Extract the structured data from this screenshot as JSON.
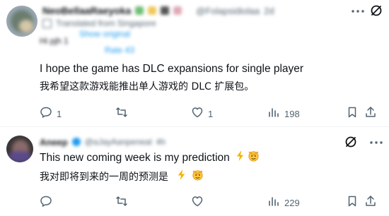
{
  "tweet1": {
    "display_name": "NeoBellaaRaeyoka",
    "handle": "@Folapsidiolaa",
    "time": "2d",
    "translate_line": "Translated from Singapore",
    "show_original": "Show original",
    "tag_a": "Hi pjh 1",
    "tag_b": "Rate 43",
    "text_en": "I hope the game has DLC expansions for single player",
    "text_zh": "我希望这款游戏能推出单人游戏的 DLC 扩展包。",
    "reply_count": "1",
    "retweet_count": "",
    "like_count": "1",
    "view_count": "198"
  },
  "tweet2": {
    "display_name": "Aneep",
    "handle": "@aJayAanpeneal",
    "time": "4h",
    "text_en": "This new coming week is my prediction",
    "text_zh": "我对即将到来的一周的预测是",
    "emoji_1": "⚡",
    "emoji_2": "🫡",
    "reply_count": "",
    "retweet_count": "",
    "like_count": "",
    "view_count": "229"
  },
  "colors": {
    "text": "#0f1419",
    "muted": "#536471",
    "link": "#1d9bf0",
    "divider": "#eff3f4"
  }
}
